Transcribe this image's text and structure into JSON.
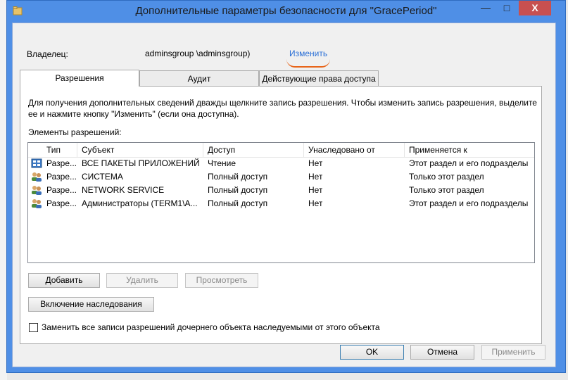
{
  "window": {
    "title": "Дополнительные параметры безопасности  для \"GracePeriod\"",
    "minimize": "—",
    "maximize": "□",
    "close": "X"
  },
  "owner": {
    "label": "Владелец:",
    "value": "adminsgroup             \\adminsgroup)",
    "change_link": "Изменить",
    "annotation_color": "#e8651a"
  },
  "tabs": [
    {
      "label": "Разрешения",
      "active": true
    },
    {
      "label": "Аудит",
      "active": false
    },
    {
      "label": "Действующие права доступа",
      "active": false
    }
  ],
  "permissions": {
    "help_text": "Для получения дополнительных сведений дважды щелкните запись разрешения. Чтобы изменить запись разрешения, выделите ее и нажмите кнопку \"Изменить\" (если она доступна).",
    "elements_label": "Элементы разрешений:",
    "columns": [
      "Тип",
      "Субъект",
      "Доступ",
      "Унаследовано от",
      "Применяется к"
    ],
    "rows": [
      {
        "icon": "app-packages-icon",
        "type": "Разре...",
        "subject": "ВСЕ ПАКЕТЫ ПРИЛОЖЕНИЙ",
        "access": "Чтение",
        "inherited": "Нет",
        "applies": "Этот раздел и его подразделы"
      },
      {
        "icon": "users-icon",
        "type": "Разре...",
        "subject": "СИСТЕМА",
        "access": "Полный доступ",
        "inherited": "Нет",
        "applies": "Только этот раздел"
      },
      {
        "icon": "users-icon",
        "type": "Разре...",
        "subject": "NETWORK SERVICE",
        "access": "Полный доступ",
        "inherited": "Нет",
        "applies": "Только этот раздел"
      },
      {
        "icon": "users-icon",
        "type": "Разре...",
        "subject": "Администраторы (TERM1\\А...",
        "access": "Полный доступ",
        "inherited": "Нет",
        "applies": "Этот раздел и его подразделы"
      }
    ],
    "add_button": "Добавить",
    "remove_button": "Удалить",
    "view_button": "Просмотреть",
    "inheritance_button": "Включение наследования",
    "replace_checkbox_label": "Заменить все записи разрешений дочернего объекта наследуемыми от этого объекта"
  },
  "footer": {
    "ok": "OK",
    "cancel": "Отмена",
    "apply": "Применить"
  }
}
